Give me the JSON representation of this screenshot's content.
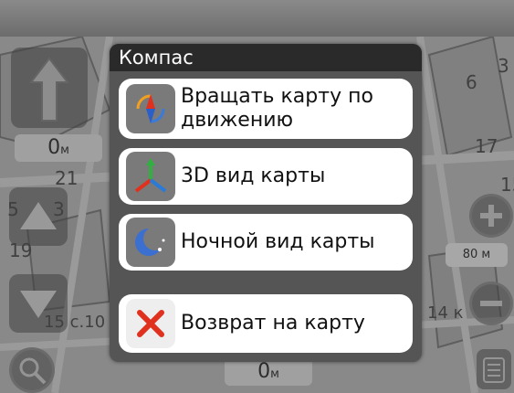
{
  "map": {
    "labels": [
      "6",
      "3",
      "17",
      "15",
      "21",
      "5",
      "3",
      "19",
      "15 с.10",
      "14 к"
    ],
    "top_distance": {
      "value": "0",
      "unit": "м"
    },
    "bottom_distance": {
      "value": "0",
      "unit": "м"
    },
    "scale": "80 м"
  },
  "dialog": {
    "title": "Компас",
    "items": [
      {
        "label": "Вращать карту по движению",
        "icon": "rotate-compass-icon"
      },
      {
        "label": "3D вид карты",
        "icon": "3d-axes-icon"
      },
      {
        "label": "Ночной вид карты",
        "icon": "moon-icon"
      },
      {
        "label": "Возврат на карту",
        "icon": "close-x-icon"
      }
    ]
  },
  "colors": {
    "dialog_bg": "#555555",
    "title_bg": "#2a2a2a",
    "item_bg": "#ffffff",
    "close_red": "#e0301e",
    "moon_blue": "#3b6fd0"
  }
}
